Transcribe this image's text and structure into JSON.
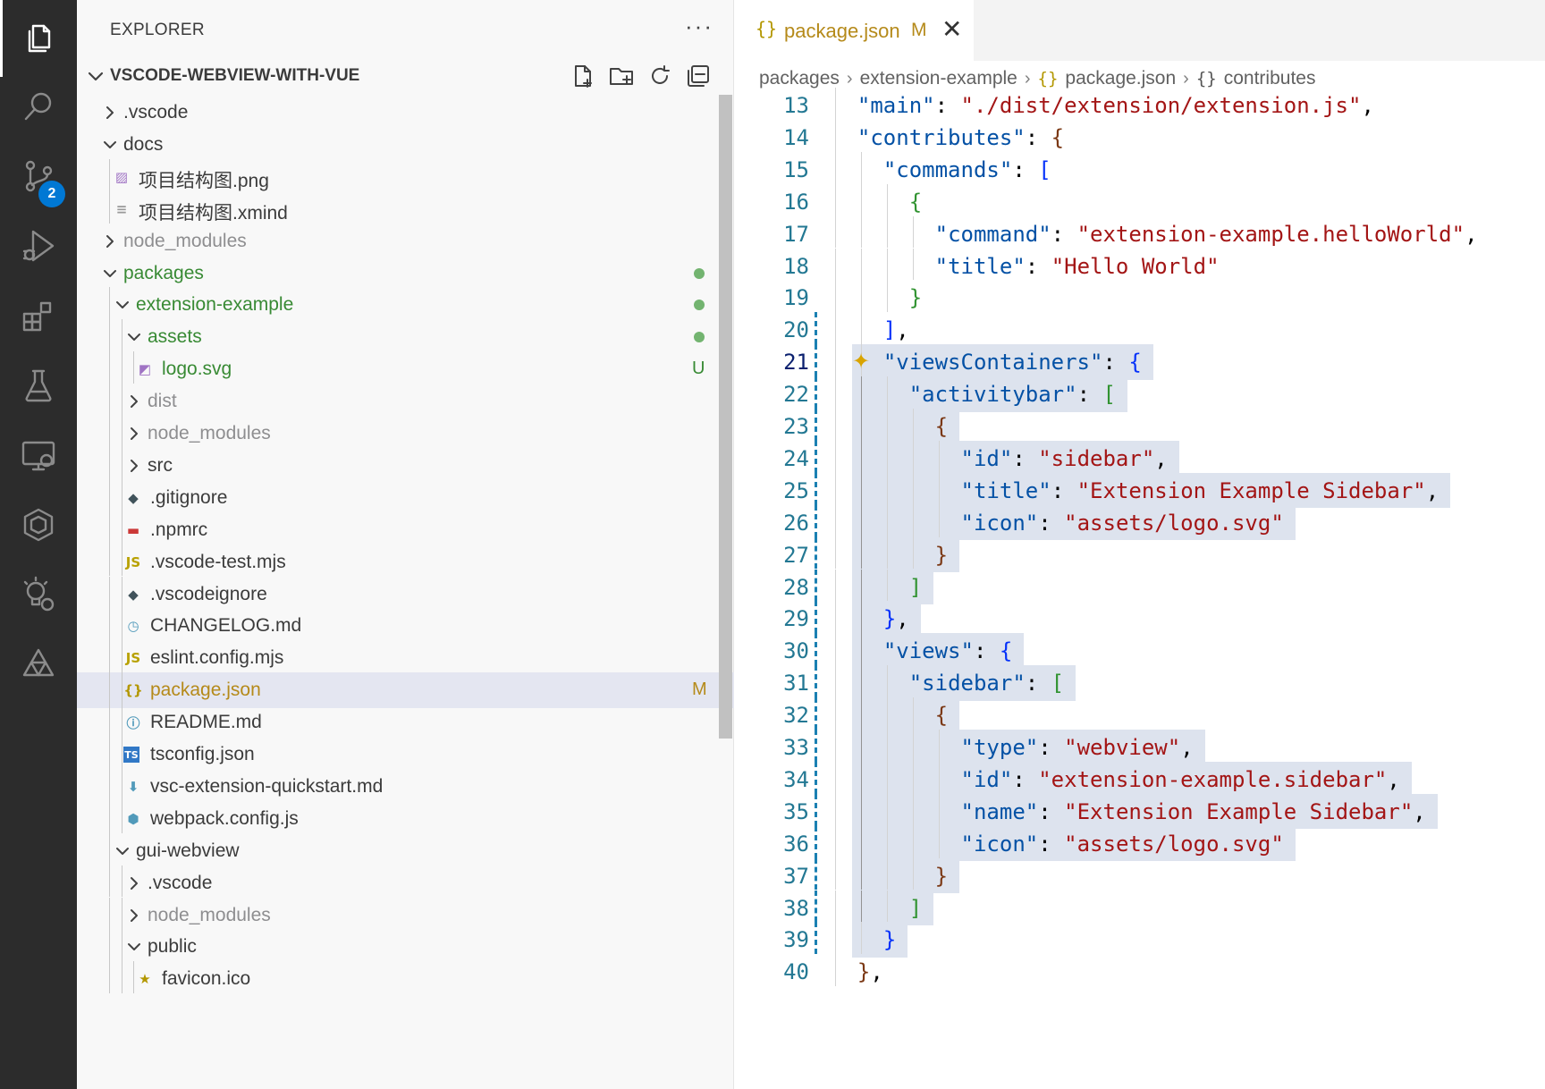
{
  "activity_bar": {
    "items": [
      {
        "name": "explorer",
        "icon": "files-icon",
        "active": true
      },
      {
        "name": "search",
        "icon": "search-icon"
      },
      {
        "name": "source-control",
        "icon": "source-control-icon",
        "badge": "2"
      },
      {
        "name": "run-debug",
        "icon": "run-debug-icon"
      },
      {
        "name": "extensions",
        "icon": "extensions-icon"
      },
      {
        "name": "testing",
        "icon": "beaker-icon"
      },
      {
        "name": "remote-explorer",
        "icon": "remote-explorer-icon"
      },
      {
        "name": "extension-hexagon",
        "icon": "hexagon-icon"
      },
      {
        "name": "extension-bulb",
        "icon": "lightbulb-icon"
      },
      {
        "name": "extension-triangle",
        "icon": "triangle-logo-icon"
      }
    ]
  },
  "sidebar": {
    "title": "EXPLORER",
    "more": "···",
    "workspace": "VSCODE-WEBVIEW-WITH-VUE",
    "tree": [
      {
        "label": ".vscode",
        "type": "folder",
        "expanded": false,
        "level": 0
      },
      {
        "label": "docs",
        "type": "folder",
        "expanded": true,
        "level": 0
      },
      {
        "label": "项目结构图.png",
        "type": "file",
        "icon": "image-file-icon",
        "level": 1
      },
      {
        "label": "项目结构图.xmind",
        "type": "file",
        "icon": "text-file-icon",
        "level": 1
      },
      {
        "label": "node_modules",
        "type": "folder",
        "expanded": false,
        "level": 0,
        "ignored": true
      },
      {
        "label": "packages",
        "type": "folder",
        "expanded": true,
        "level": 0,
        "status": "dot",
        "color": "green"
      },
      {
        "label": "extension-example",
        "type": "folder",
        "expanded": true,
        "level": 1,
        "status": "dot",
        "color": "green"
      },
      {
        "label": "assets",
        "type": "folder",
        "expanded": true,
        "level": 2,
        "status": "dot",
        "color": "green"
      },
      {
        "label": "logo.svg",
        "type": "file",
        "icon": "svg-file-icon",
        "level": 3,
        "decoration": "U",
        "color": "green"
      },
      {
        "label": "dist",
        "type": "folder",
        "expanded": false,
        "level": 2,
        "ignored": true
      },
      {
        "label": "node_modules",
        "type": "folder",
        "expanded": false,
        "level": 2,
        "ignored": true
      },
      {
        "label": "src",
        "type": "folder",
        "expanded": false,
        "level": 2
      },
      {
        "label": ".gitignore",
        "type": "file",
        "icon": "git-file-icon",
        "level": 2
      },
      {
        "label": ".npmrc",
        "type": "file",
        "icon": "npm-file-icon",
        "level": 2
      },
      {
        "label": ".vscode-test.mjs",
        "type": "file",
        "icon": "js-file-icon",
        "level": 2
      },
      {
        "label": ".vscodeignore",
        "type": "file",
        "icon": "git-file-icon",
        "level": 2
      },
      {
        "label": "CHANGELOG.md",
        "type": "file",
        "icon": "changelog-file-icon",
        "level": 2
      },
      {
        "label": "eslint.config.mjs",
        "type": "file",
        "icon": "js-file-icon",
        "level": 2
      },
      {
        "label": "package.json",
        "type": "file",
        "icon": "json-file-icon",
        "level": 2,
        "decoration": "M",
        "color": "modified",
        "selected": true
      },
      {
        "label": "README.md",
        "type": "file",
        "icon": "info-file-icon",
        "level": 2
      },
      {
        "label": "tsconfig.json",
        "type": "file",
        "icon": "ts-file-icon",
        "level": 2
      },
      {
        "label": "vsc-extension-quickstart.md",
        "type": "file",
        "icon": "download-file-icon",
        "level": 2
      },
      {
        "label": "webpack.config.js",
        "type": "file",
        "icon": "webpack-file-icon",
        "level": 2
      },
      {
        "label": "gui-webview",
        "type": "folder",
        "expanded": true,
        "level": 1
      },
      {
        "label": ".vscode",
        "type": "folder",
        "expanded": false,
        "level": 2
      },
      {
        "label": "node_modules",
        "type": "folder",
        "expanded": false,
        "level": 2,
        "ignored": true
      },
      {
        "label": "public",
        "type": "folder",
        "expanded": true,
        "level": 2
      },
      {
        "label": "favicon.ico",
        "type": "file",
        "icon": "star-file-icon",
        "level": 3
      }
    ]
  },
  "editor": {
    "tab": {
      "label": "package.json",
      "modified": "M",
      "icon": "{}",
      "close": "✕"
    },
    "breadcrumbs": [
      "packages",
      "extension-example",
      "package.json",
      "contributes"
    ],
    "breadcrumb_icons": {
      "json": "{}",
      "object": "{}"
    },
    "lines": [
      {
        "n": "13",
        "code": "  \"main\": \"./dist/extension/extension.js\","
      },
      {
        "n": "14",
        "code": "  \"contributes\": {"
      },
      {
        "n": "15",
        "code": "    \"commands\": ["
      },
      {
        "n": "16",
        "code": "      {"
      },
      {
        "n": "17",
        "code": "        \"command\": \"extension-example.helloWorld\","
      },
      {
        "n": "18",
        "code": "        \"title\": \"Hello World\""
      },
      {
        "n": "19",
        "code": "      }"
      },
      {
        "n": "20",
        "code": "    ],"
      },
      {
        "n": "21",
        "code": "    \"viewsContainers\": {"
      },
      {
        "n": "22",
        "code": "      \"activitybar\": ["
      },
      {
        "n": "23",
        "code": "        {"
      },
      {
        "n": "24",
        "code": "          \"id\": \"sidebar\","
      },
      {
        "n": "25",
        "code": "          \"title\": \"Extension Example Sidebar\","
      },
      {
        "n": "26",
        "code": "          \"icon\": \"assets/logo.svg\""
      },
      {
        "n": "27",
        "code": "        }"
      },
      {
        "n": "28",
        "code": "      ]"
      },
      {
        "n": "29",
        "code": "    },"
      },
      {
        "n": "30",
        "code": "    \"views\": {"
      },
      {
        "n": "31",
        "code": "      \"sidebar\": ["
      },
      {
        "n": "32",
        "code": "        {"
      },
      {
        "n": "33",
        "code": "          \"type\": \"webview\","
      },
      {
        "n": "34",
        "code": "          \"id\": \"extension-example.sidebar\","
      },
      {
        "n": "35",
        "code": "          \"name\": \"Extension Example Sidebar\","
      },
      {
        "n": "36",
        "code": "          \"icon\": \"assets/logo.svg\""
      },
      {
        "n": "37",
        "code": "        }"
      },
      {
        "n": "38",
        "code": "      ]"
      },
      {
        "n": "39",
        "code": "    }"
      },
      {
        "n": "40",
        "code": "  },"
      }
    ],
    "current_line": "21",
    "added_lines_from": "20",
    "added_lines_to": "39"
  },
  "colors": {
    "activity_bg": "#2c2c2c",
    "sidebar_bg": "#f8f8f8",
    "badge": "#0078d4",
    "git_added": "#388a34",
    "git_modified": "#b58a1a",
    "selection": "#dde3ee",
    "json_key": "#0451a5",
    "json_string": "#a31515"
  }
}
